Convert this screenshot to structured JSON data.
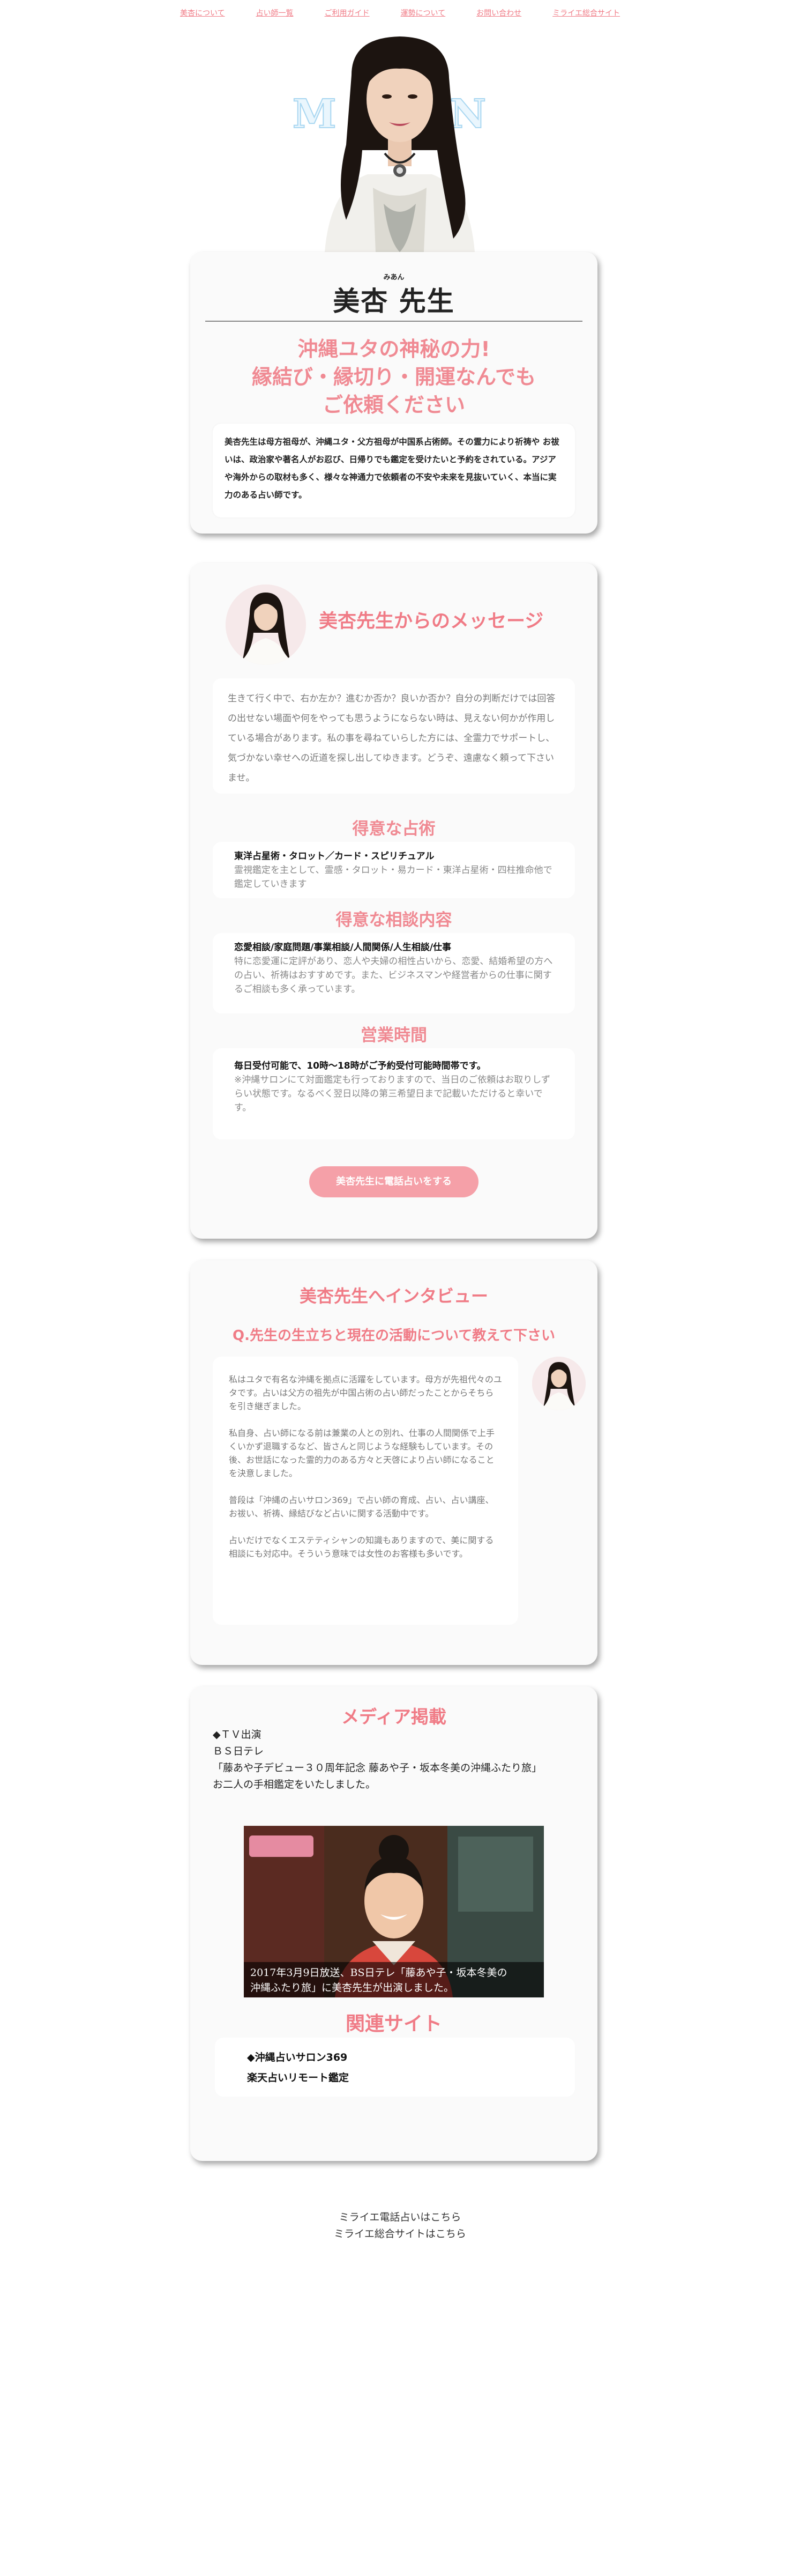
{
  "nav": {
    "items": [
      {
        "label": "美杏について"
      },
      {
        "label": "占い師一覧"
      },
      {
        "label": "ご利用ガイド"
      },
      {
        "label": "運勢について"
      },
      {
        "label": "お問い合わせ"
      },
      {
        "label": "ミライエ総合サイト"
      }
    ]
  },
  "hero": {
    "title": "MIAN"
  },
  "profile": {
    "ruby": "みあん",
    "name": "美杏 先生",
    "catch_lines": [
      "沖縄ユタの神秘の力!",
      "縁結び・縁切り・開運なんでも",
      "ご依頼ください"
    ],
    "intro": "美杏先生は母方祖母が、沖縄ユタ・父方祖母が中国系占術師。その霊力により祈祷や お祓いは、政治家や著名人がお忍び、日帰りでも鑑定を受けたいと予約をされている。アジアや海外からの取材も多く、様々な神通力で依頼者の不安や未来を見抜いていく、本当に実力のある占い師です。"
  },
  "message": {
    "title": "美杏先生からのメッセージ",
    "body": "生きて行く中で、右か左か？進むか否か？良いか否か？自分の判断だけでは回答の出せない場面や何をやっても思うようにならない時は、見えない何かが作用している場合があります。私の事を尋ねていらした方には、全霊力でサポートし、気づかない幸せへの近道を探し出してゆきます。どうぞ、遠慮なく頼って下さいませ。",
    "skills_title": "得意な占術",
    "skills_main": "東洋占星術・タロット／カード・スピリチュアル",
    "skills_sub": "霊視鑑定を主として、霊感・タロット・易カード・東洋占星術・四柱推命他で鑑定していきます",
    "consult_title": "得意な相談内容",
    "consult_main": "恋愛相談/家庭問題/事業相談/人間関係/人生相談/仕事",
    "consult_sub": "特に恋愛運に定評があり、恋人や夫婦の相性占いから、恋愛、結婚希望の方への占い、祈祷はおすすめです。また、ビジネスマンや経営者からの仕事に関するご相談も多く承っています。",
    "hours_title": "営業時間",
    "hours_main": "毎日受付可能で、10時～18時がご予約受付可能時間帯です。",
    "hours_sub": "※沖縄サロンにて対面鑑定も行っておりますので、当日のご依頼はお取りしずらい状態です。なるべく翌日以降の第三希望日まで記載いただけると幸いです。",
    "button": "美杏先生に電話占いをする"
  },
  "interview": {
    "title": "美杏先生へインタビュー",
    "question": "Q.先生の生立ちと現在の活動について教えて下さい",
    "paragraphs": [
      "私はユタで有名な沖縄を拠点に活躍をしています。母方が先祖代々のユタです。占いは父方の祖先が中国占術の占い師だったことからそちらを引き継ぎました。",
      "私自身、占い師になる前は兼業の人との別れ、仕事の人間関係で上手くいかず退職するなど、皆さんと同じような経験もしています。その後、お世話になった霊的力のある方々と天啓により占い師になることを決意しました。",
      "普段は「沖縄の占いサロン369」で占い師の育成、占い、占い講座、お祓い、祈祷、縁結びなど占いに関する活動中です。",
      "占いだけでなくエステティシャンの知識もありますので、美に関する相談にも対応中。そういう意味では女性のお客様も多いです。"
    ]
  },
  "media": {
    "title": "メディア掲載",
    "lines": [
      "◆ＴＶ出演",
      "ＢＳ日テレ",
      "「藤あや子デビュー３０周年記念 藤あや子・坂本冬美の沖縄ふたり旅」",
      "お二人の手相鑑定をいたしました。"
    ],
    "caption_line1": "2017年3月9日放送、BS日テレ「藤あや子・坂本冬美の",
    "caption_line2": "沖縄ふたり旅」に美杏先生が出演しました。",
    "related_title": "関連サイト",
    "related_links": [
      "◆沖縄占いサロン369",
      "楽天占いリモート鑑定"
    ]
  },
  "footer": {
    "links": [
      "ミライエ電話占いはこちら",
      "ミライエ総合サイトはこちら"
    ]
  },
  "colors": {
    "accent": "#f07b86",
    "button": "#f5a0a8",
    "card_bg": "#fafafa"
  }
}
